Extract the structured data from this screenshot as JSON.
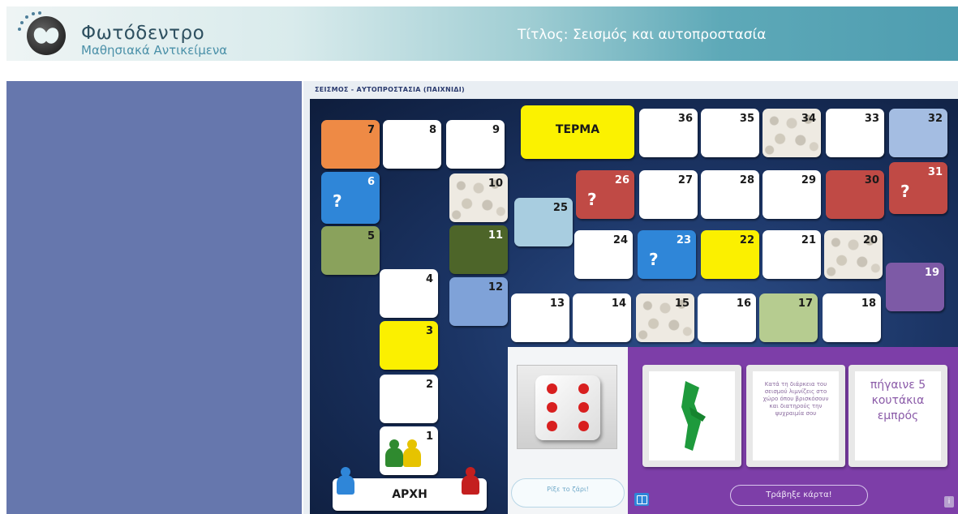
{
  "header": {
    "brand_title": "Φωτόδεντρο",
    "brand_subtitle": "Μαθησιακά Αντικείμενα",
    "title": "Τίτλος:  Σεισμός και αυτοπροστασία"
  },
  "game": {
    "caption": "ΣΕΙΣΜΟΣ - ΑΥΤΟΠΡΟΣΤΑΣΙΑ (ΠΑΙΧΝΙΔΙ)",
    "finish_label": "ΤΕΡΜΑ",
    "start_label": "ΑΡΧΗ",
    "question_mark": "?",
    "cells": {
      "c1": "1",
      "c2": "2",
      "c3": "3",
      "c4": "4",
      "c5": "5",
      "c6": "6",
      "c7": "7",
      "c8": "8",
      "c9": "9",
      "c10": "10",
      "c11": "11",
      "c12": "12",
      "c13": "13",
      "c14": "14",
      "c15": "15",
      "c16": "16",
      "c17": "17",
      "c18": "18",
      "c19": "19",
      "c20": "20",
      "c21": "21",
      "c22": "22",
      "c23": "23",
      "c24": "24",
      "c25": "25",
      "c26": "26",
      "c27": "27",
      "c28": "28",
      "c29": "29",
      "c30": "30",
      "c31": "31",
      "c32": "32",
      "c33": "33",
      "c34": "34",
      "c35": "35",
      "c36": "36"
    },
    "dice_value": 6,
    "roll_button_label": "Ρίξε το ζάρι!",
    "card_text_small": "Κατά τη διάρκεια του σεισμού λιμνίζεις στο χώρο όπου βρισκόσουν και διατηρούς την ψυχραιμία σου",
    "card_text_big": "πήγαινε 5 κουτάκια εμπρός",
    "draw_card_label": "Τράβηξε κάρτα!",
    "info_label": "i"
  },
  "colors": {
    "left_panel": "#6677ad",
    "cards_panel": "#7d3ea8",
    "board_bg": "#1b3464",
    "pawn_blue": "#2f86d8",
    "pawn_red": "#c41f1f",
    "pawn_green": "#2f8a2f",
    "pawn_yellow": "#e6c300"
  }
}
